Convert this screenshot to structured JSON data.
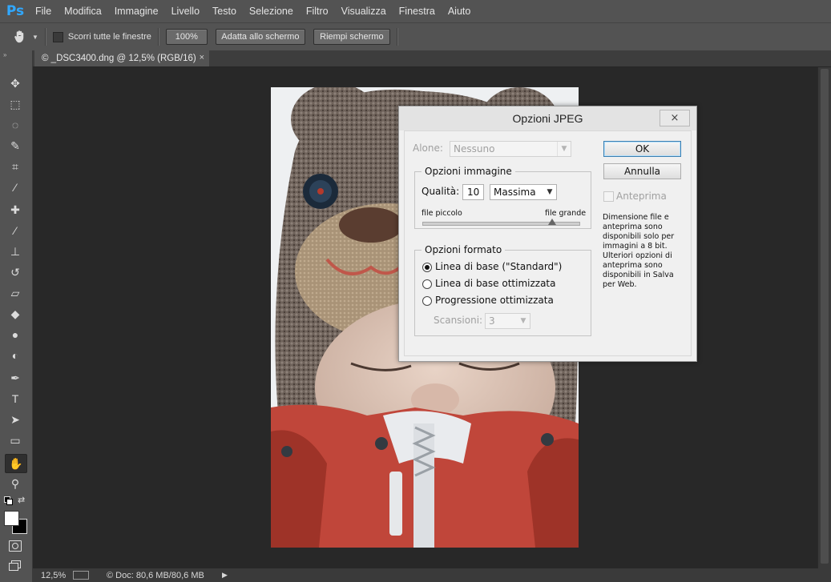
{
  "app": {
    "logo": "Ps",
    "accent": "#31a8ff"
  },
  "menu": [
    "File",
    "Modifica",
    "Immagine",
    "Livello",
    "Testo",
    "Selezione",
    "Filtro",
    "Visualizza",
    "Finestra",
    "Aiuto"
  ],
  "options_bar": {
    "tool_icon": "hand-icon",
    "scroll_all_label": "Scorri tutte le finestre",
    "zoom_button": "100%",
    "fit_screen_button": "Adatta allo schermo",
    "fill_screen_button": "Riempi schermo"
  },
  "document_tab": {
    "title": "© _DSC3400.dng @ 12,5% (RGB/16)",
    "close": "×"
  },
  "status_bar": {
    "zoom": "12,5%",
    "doc_info": "© Doc: 80,6 MB/80,6 MB",
    "arrow": "▶"
  },
  "tools": [
    "move-icon",
    "marquee-icon",
    "lasso-icon",
    "quick-select-icon",
    "crop-icon",
    "eyedropper-icon",
    "healing-icon",
    "brush-icon",
    "stamp-icon",
    "history-brush-icon",
    "eraser-icon",
    "bucket-icon",
    "blur-icon",
    "dodge-icon",
    "pen-icon",
    "type-icon",
    "path-select-icon",
    "rectangle-icon",
    "hand-icon",
    "zoom-icon"
  ],
  "dialog": {
    "title": "Opzioni JPEG",
    "close": "×",
    "matte_label": "Alone:",
    "matte_value": "Nessuno",
    "ok_label": "OK",
    "cancel_label": "Annulla",
    "preview_label": "Anteprima",
    "image_options": {
      "title": "Opzioni immagine",
      "quality_label": "Qualità:",
      "quality_value": "10",
      "quality_preset": "Massima",
      "small_file": "file piccolo",
      "large_file": "file grande",
      "slider_fraction": 0.83
    },
    "format_options": {
      "title": "Opzioni formato",
      "options": [
        "Linea di base (\"Standard\")",
        "Linea di base ottimizzata",
        "Progressione ottimizzata"
      ],
      "selected_index": 0,
      "scans_label": "Scansioni:",
      "scans_value": "3"
    },
    "info_text": "Dimensione file e anteprima sono disponibili solo per immagini a 8 bit. Ulteriori opzioni di anteprima sono disponibili in Salva per Web."
  }
}
